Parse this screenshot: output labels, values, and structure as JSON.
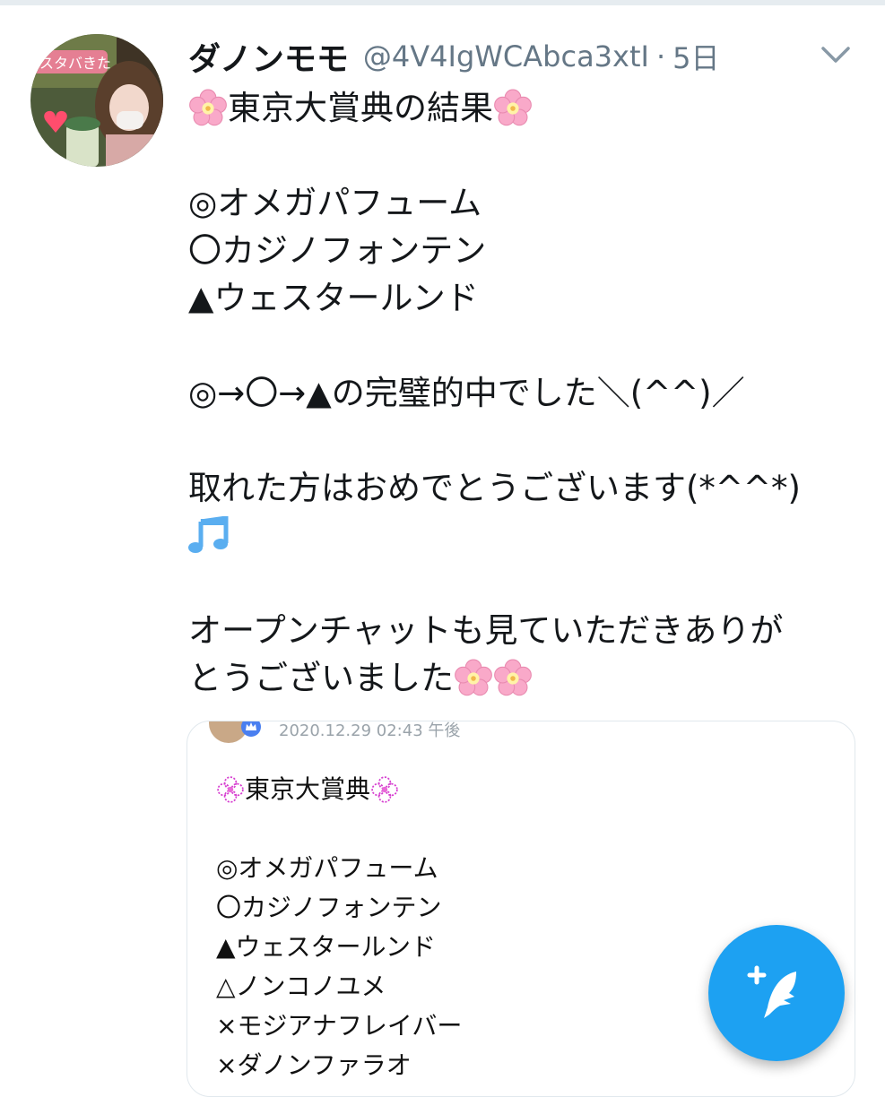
{
  "tweet": {
    "display_name": "ダノンモモ",
    "handle": "@4V4IgWCAbca3xtI",
    "separator": "·",
    "time": "5日",
    "title": "東京大賞典の結果",
    "picks": [
      "◎オメガパフューム",
      "〇カジノフォンテン",
      "▲ウェスタールンド"
    ],
    "result": "◎→〇→▲の完璧的中でした＼(^^)／",
    "congrats": "取れた方はおめでとうございます(*^^*)",
    "thanks_line1": "オープンチャットも見ていただきありが",
    "thanks_line2": "とうございました"
  },
  "avatar": {
    "sticker_text": "スタバきた"
  },
  "quoted_image": {
    "date": "2020.12.29 02:43 午後",
    "title": "東京大賞典",
    "picks": [
      "◎オメガパフューム",
      "〇カジノフォンテン",
      "▲ウェスタールンド",
      "△ノンコノユメ",
      "×モジアナフレイバー",
      "×ダノンファラオ"
    ]
  },
  "icons": {
    "cherry_blossom": "cherry-blossom-icon",
    "music_note": "musical-notes-icon",
    "chevron": "chevron-down-icon",
    "compose": "compose-tweet-icon"
  },
  "colors": {
    "accent": "#1da1f2",
    "text": "#14171a",
    "muted": "#657786",
    "blossom": "#f7a8c8",
    "music": "#5aaef0"
  }
}
